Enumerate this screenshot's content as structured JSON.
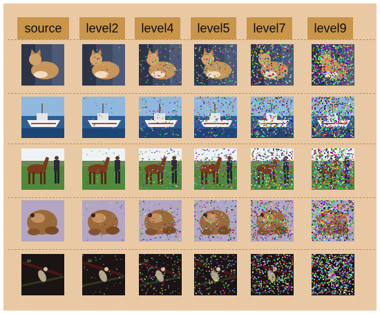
{
  "headers": [
    "source",
    "level2",
    "level4",
    "level5",
    "level7",
    "level9"
  ],
  "rows": [
    {
      "name": "cat",
      "noise_levels": [
        0,
        2,
        4,
        5,
        7,
        9
      ]
    },
    {
      "name": "ship",
      "noise_levels": [
        0,
        2,
        4,
        5,
        7,
        9
      ]
    },
    {
      "name": "horse",
      "noise_levels": [
        0,
        2,
        4,
        5,
        7,
        9
      ]
    },
    {
      "name": "frog",
      "noise_levels": [
        0,
        2,
        4,
        5,
        7,
        9
      ]
    },
    {
      "name": "bird",
      "noise_levels": [
        0,
        2,
        4,
        5,
        7,
        9
      ]
    }
  ],
  "colors": {
    "panel": "#e9c9a3",
    "header": "#c8954a",
    "separator": "#c98a3e"
  }
}
